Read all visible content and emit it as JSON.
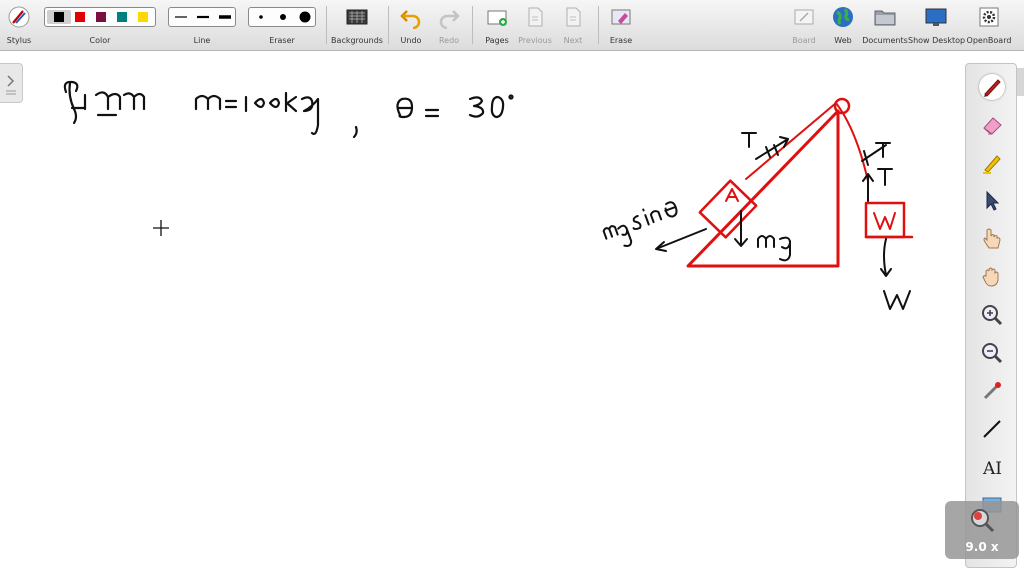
{
  "toolbar": {
    "stylus": "Stylus",
    "color": "Color",
    "line": "Line",
    "eraser": "Eraser",
    "backgrounds": "Backgrounds",
    "undo": "Undo",
    "redo": "Redo",
    "pages": "Pages",
    "previous": "Previous",
    "next": "Next",
    "erase": "Erase",
    "board": "Board",
    "web": "Web",
    "documents": "Documents",
    "show_desktop": "Show Desktop",
    "openboard": "OpenBoard"
  },
  "colors": {
    "swatches": [
      "#000000",
      "#e00000",
      "#7a1040",
      "#007f7f",
      "#ffd800"
    ],
    "ink_black": "#111111",
    "ink_red": "#e01010"
  },
  "side_tools": [
    "pen-icon",
    "eraser-icon",
    "highlighter-icon",
    "pointer-icon",
    "hand-icon",
    "pan-icon",
    "zoom-in-icon",
    "zoom-out-icon",
    "laser-icon",
    "line-icon",
    "text-icon",
    "capture-icon"
  ],
  "zoom": {
    "level": "9.0 x"
  }
}
